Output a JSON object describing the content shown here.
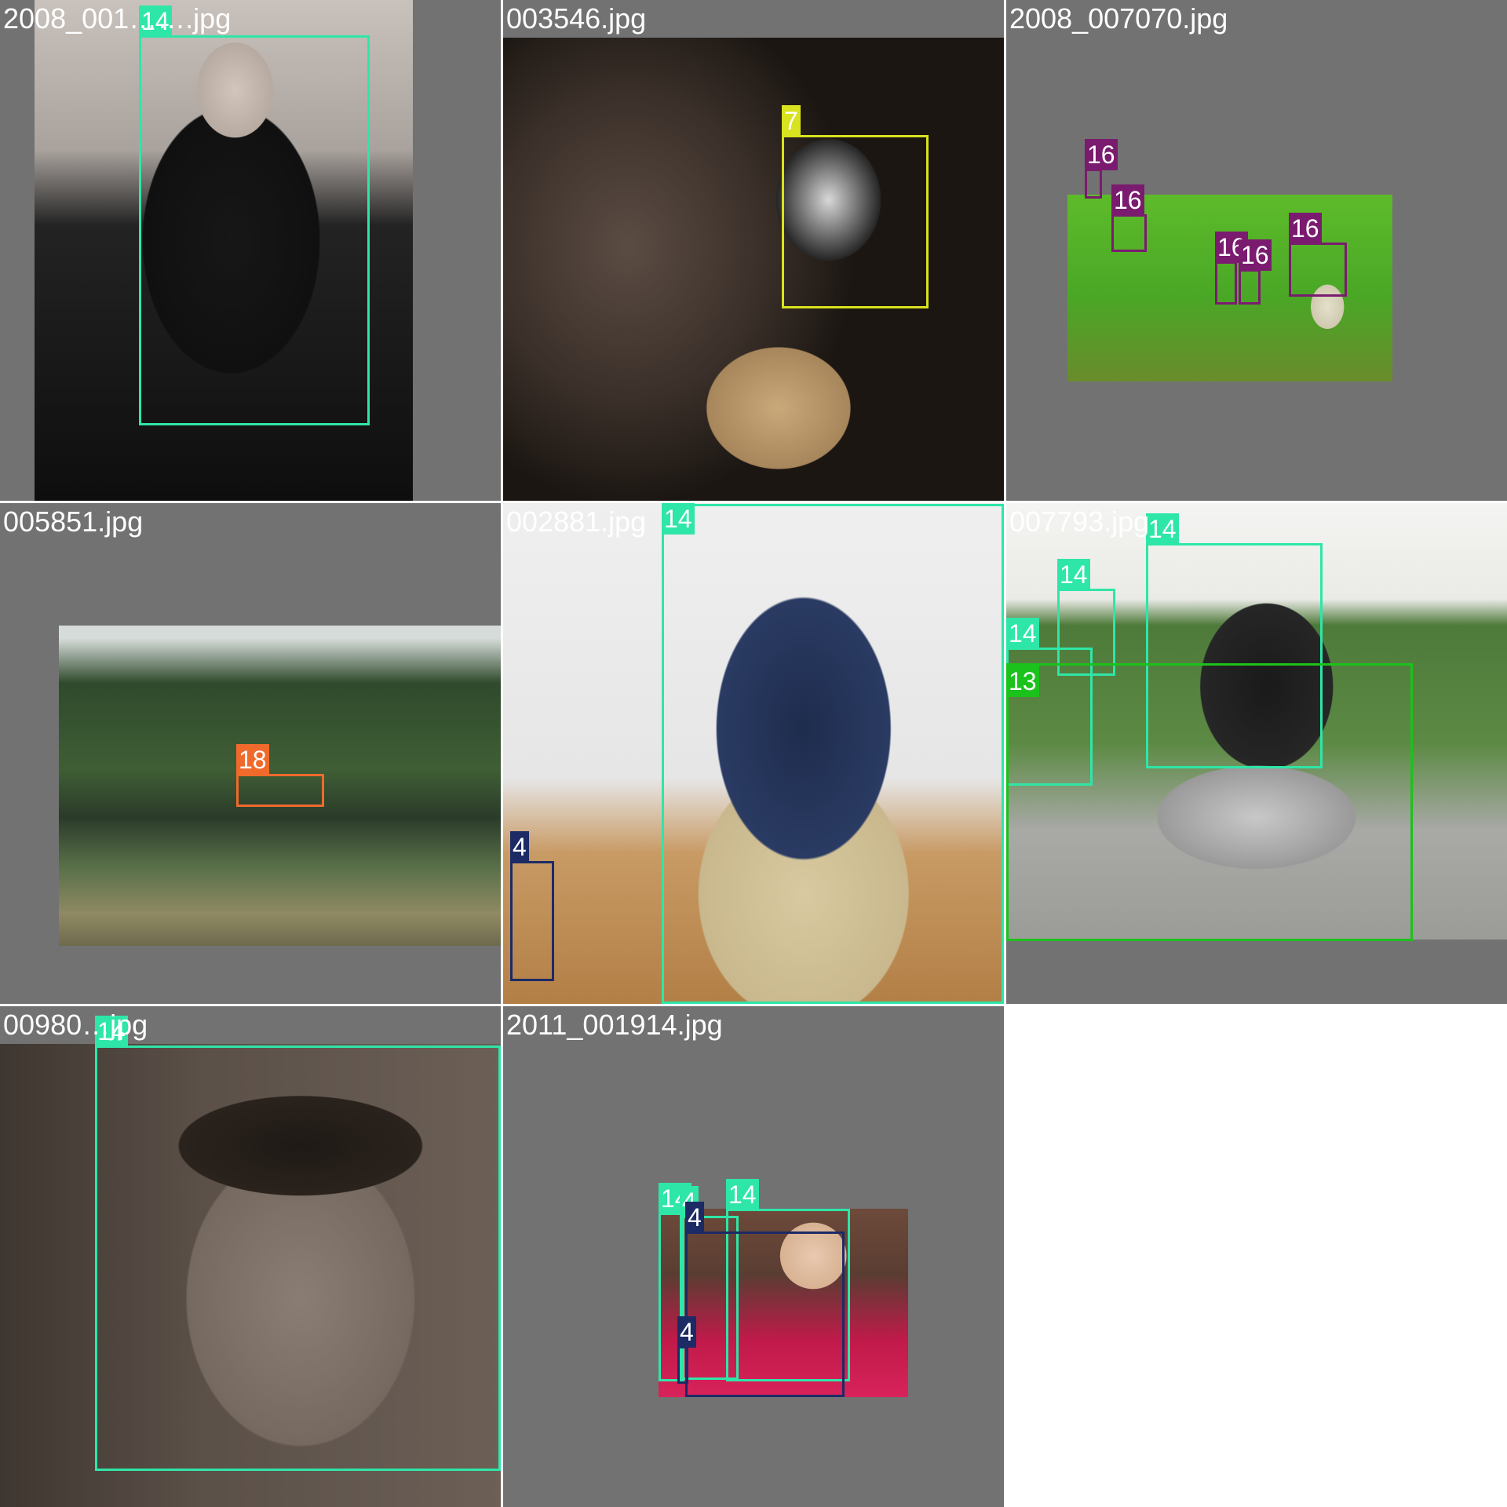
{
  "grid": {
    "tiles": [
      {
        "filename": "2008_001…….jpg",
        "scene": "guitarist-stage",
        "detections": [
          {
            "label": "14",
            "color": "#2ee6a8"
          }
        ]
      },
      {
        "filename": "003546.jpg",
        "scene": "rabbit-cat",
        "detections": [
          {
            "label": "7",
            "color": "#d8e21e"
          }
        ]
      },
      {
        "filename": "2008_007070.jpg",
        "scene": "sheep-field",
        "detections": [
          {
            "label": "16",
            "color": "#7a1b6f"
          },
          {
            "label": "16",
            "color": "#7a1b6f"
          },
          {
            "label": "16",
            "color": "#7a1b6f"
          },
          {
            "label": "16",
            "color": "#7a1b6f"
          },
          {
            "label": "16",
            "color": "#7a1b6f"
          }
        ]
      },
      {
        "filename": "005851.jpg",
        "scene": "train-valley",
        "detections": [
          {
            "label": "18",
            "color": "#f06a2c"
          }
        ]
      },
      {
        "filename": "002881.jpg",
        "scene": "man-bench",
        "detections": [
          {
            "label": "14",
            "color": "#2ee6a8"
          },
          {
            "label": "4",
            "color": "#1c2a66"
          }
        ]
      },
      {
        "filename": "007793.jpg",
        "scene": "motorcycle",
        "detections": [
          {
            "label": "14",
            "color": "#2ee6a8"
          },
          {
            "label": "14",
            "color": "#2ee6a8"
          },
          {
            "label": "14",
            "color": "#2ee6a8"
          },
          {
            "label": "13",
            "color": "#1bc21b"
          }
        ]
      },
      {
        "filename": "00980…jpg",
        "scene": "face-closeup",
        "detections": [
          {
            "label": "14",
            "color": "#2ee6a8"
          }
        ]
      },
      {
        "filename": "2011_001914.jpg",
        "scene": "group-couch",
        "detections": [
          {
            "label": "14",
            "color": "#2ee6a8"
          },
          {
            "label": "4",
            "color": "#2ee6a8"
          },
          {
            "label": "14",
            "color": "#2ee6a8"
          },
          {
            "label": "4",
            "color": "#1c2a66"
          },
          {
            "label": "4",
            "color": "#1c2a66"
          }
        ]
      }
    ]
  }
}
